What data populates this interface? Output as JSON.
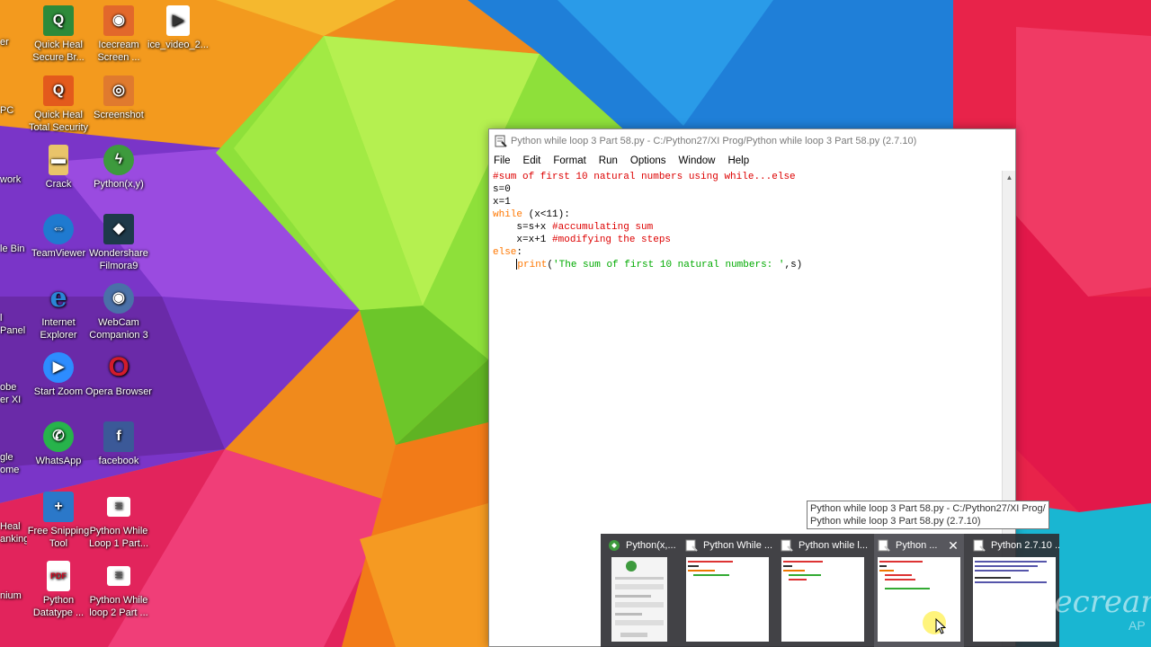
{
  "desktop": {
    "edge_labels": [
      "er",
      "PC",
      "work",
      "le Bin",
      "l Panel",
      "obe",
      "er XI",
      "gle",
      "ome",
      "Heal",
      "anking",
      "nium"
    ],
    "icons": [
      {
        "name": "quick-heal-secure-browser-icon",
        "label": "Quick Heal Secure Br...",
        "color": "#2d8a3a",
        "glyph": "Q"
      },
      {
        "name": "icecream-screen-icon",
        "label": "Icecream Screen ...",
        "color": "#e2682b",
        "glyph": "◉"
      },
      {
        "name": "ice-video-icon",
        "label": "ice_video_2...",
        "color": "#ffffff",
        "glyph": "▶"
      },
      {
        "name": "quick-heal-total-security-icon",
        "label": "Quick Heal Total Security",
        "color": "#e35a1c",
        "glyph": "Q"
      },
      {
        "name": "screenshot-icon",
        "label": "Screenshot",
        "color": "#e07a2e",
        "glyph": "◎"
      },
      {
        "name": "crack-folder-icon",
        "label": "Crack",
        "color": "#e9c46a",
        "glyph": "▬"
      },
      {
        "name": "pythonxy-icon",
        "label": "Python(x,y)",
        "color": "#3d9a3d",
        "glyph": "ϟ"
      },
      {
        "name": "teamviewer-icon",
        "label": "TeamViewer",
        "color": "#1f7ad0",
        "glyph": "⇔"
      },
      {
        "name": "wondershare-filmora-icon",
        "label": "Wondershare Filmora9",
        "color": "#1e3a4a",
        "glyph": "◆"
      },
      {
        "name": "internet-explorer-icon",
        "label": "Internet Explorer",
        "color": "#2a86d6",
        "glyph": "e"
      },
      {
        "name": "webcam-companion-icon",
        "label": "WebCam Companion 3",
        "color": "#4a70a8",
        "glyph": "◉"
      },
      {
        "name": "start-zoom-icon",
        "label": "Start Zoom",
        "color": "#2d8cff",
        "glyph": "▶"
      },
      {
        "name": "opera-browser-icon",
        "label": "Opera Browser",
        "color": "#d21b2a",
        "glyph": "O"
      },
      {
        "name": "whatsapp-icon",
        "label": "WhatsApp",
        "color": "#27b34b",
        "glyph": "✆"
      },
      {
        "name": "facebook-icon",
        "label": "facebook",
        "color": "#3b5998",
        "glyph": "f"
      },
      {
        "name": "free-snipping-tool-icon",
        "label": "Free Snipping Tool",
        "color": "#2b78c9",
        "glyph": "+"
      },
      {
        "name": "python-while-loop-1-icon",
        "label": "Python While Loop 1 Part...",
        "color": "#ffffff",
        "glyph": "≡"
      },
      {
        "name": "python-datatype-pdf-icon",
        "label": "Python Datatype ...",
        "color": "#ffffff",
        "glyph": "PDF"
      },
      {
        "name": "python-while-loop-2-icon",
        "label": "Python While loop 2 Part ...",
        "color": "#ffffff",
        "glyph": "≡"
      }
    ]
  },
  "idle": {
    "title": "Python while loop  3 Part 58.py - C:/Python27/XI Prog/Python while loop  3 Part 58.py (2.7.10)",
    "menu": [
      "File",
      "Edit",
      "Format",
      "Run",
      "Options",
      "Window",
      "Help"
    ],
    "code": {
      "line1": "#sum of first 10 natural numbers using while...else",
      "line2": "s=0",
      "line3": "x=1",
      "line4_kw": "while",
      "line4_rest": " (x<11):",
      "line5_code": "    s=s+x ",
      "line5_com": "#accumulating sum",
      "line6_code": "    x=x+1 ",
      "line6_com": "#modifying the steps",
      "line7_kw": "else",
      "line7_rest": ":",
      "line8_indent": "    ",
      "line8_kw": "print",
      "line8_p1": "(",
      "line8_str": "'The sum of first 10 natural numbers: '",
      "line8_p2": ",s)"
    }
  },
  "tooltip": {
    "line1": "Python while loop  3 Part 58.py - C:/Python27/XI Prog/",
    "line2": "Python while loop  3 Part 58.py (2.7.10)"
  },
  "taskbar_thumbnails": [
    {
      "label": "Python(x,..."
    },
    {
      "label": "Python While ..."
    },
    {
      "label": "Python while l..."
    },
    {
      "label": "Python ..."
    },
    {
      "label": "Python 2.7.10 ..."
    }
  ],
  "watermark": {
    "text": "Icecream",
    "small": "AP"
  },
  "colors": {
    "comment": "#dd0000",
    "keyword": "#ff7700",
    "string": "#00aa00"
  }
}
